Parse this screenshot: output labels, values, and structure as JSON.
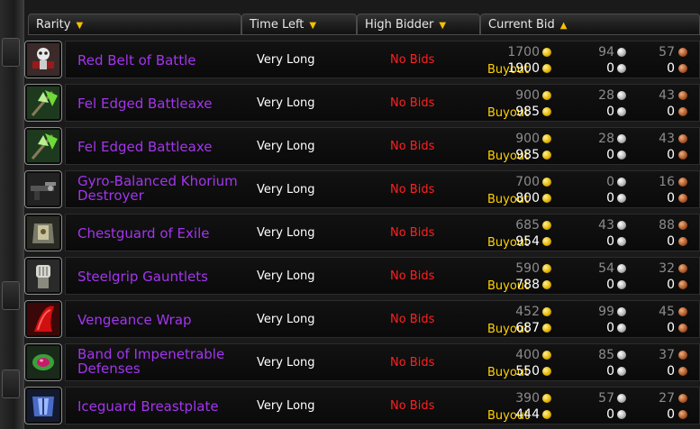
{
  "columns": [
    {
      "label": "Rarity",
      "sort": "desc"
    },
    {
      "label": "Time Left",
      "sort": "desc"
    },
    {
      "label": "High Bidder",
      "sort": "desc"
    },
    {
      "label": "Current Bid",
      "sort": "asc"
    }
  ],
  "buyout_label": "Buyout",
  "colors": {
    "epic": "#a335ee",
    "no_bids": "#ff2020",
    "buyout": "#ffd100"
  },
  "items": [
    {
      "name": "Red Belt of Battle",
      "icon": "belt-icon",
      "time": "Very Long",
      "bidder": "No Bids",
      "bid": {
        "g": "1700",
        "s": "94",
        "c": "57"
      },
      "buyout": {
        "g": "1900",
        "s": "0",
        "c": "0"
      }
    },
    {
      "name": "Fel Edged Battleaxe",
      "icon": "battleaxe-icon",
      "time": "Very Long",
      "bidder": "No Bids",
      "bid": {
        "g": "900",
        "s": "28",
        "c": "43"
      },
      "buyout": {
        "g": "985",
        "s": "0",
        "c": "0"
      }
    },
    {
      "name": "Fel Edged Battleaxe",
      "icon": "battleaxe-icon",
      "time": "Very Long",
      "bidder": "No Bids",
      "bid": {
        "g": "900",
        "s": "28",
        "c": "43"
      },
      "buyout": {
        "g": "985",
        "s": "0",
        "c": "0"
      }
    },
    {
      "name": "Gyro-Balanced Khorium Destroyer",
      "icon": "gun-icon",
      "time": "Very Long",
      "bidder": "No Bids",
      "bid": {
        "g": "700",
        "s": "0",
        "c": "16"
      },
      "buyout": {
        "g": "800",
        "s": "0",
        "c": "0"
      }
    },
    {
      "name": "Chestguard of Exile",
      "icon": "chestguard-icon",
      "time": "Very Long",
      "bidder": "No Bids",
      "bid": {
        "g": "685",
        "s": "43",
        "c": "88"
      },
      "buyout": {
        "g": "954",
        "s": "0",
        "c": "0"
      }
    },
    {
      "name": "Steelgrip Gauntlets",
      "icon": "gauntlets-icon",
      "time": "Very Long",
      "bidder": "No Bids",
      "bid": {
        "g": "590",
        "s": "54",
        "c": "32"
      },
      "buyout": {
        "g": "788",
        "s": "0",
        "c": "0"
      }
    },
    {
      "name": "Vengeance Wrap",
      "icon": "cloak-icon",
      "time": "Very Long",
      "bidder": "No Bids",
      "bid": {
        "g": "452",
        "s": "99",
        "c": "45"
      },
      "buyout": {
        "g": "687",
        "s": "0",
        "c": "0"
      }
    },
    {
      "name": "Band of Impenetrable Defenses",
      "icon": "ring-icon",
      "time": "Very Long",
      "bidder": "No Bids",
      "bid": {
        "g": "400",
        "s": "85",
        "c": "37"
      },
      "buyout": {
        "g": "550",
        "s": "0",
        "c": "0"
      }
    },
    {
      "name": "Iceguard Breastplate",
      "icon": "breastplate-icon",
      "time": "Very Long",
      "bidder": "No Bids",
      "bid": {
        "g": "390",
        "s": "57",
        "c": "27"
      },
      "buyout": {
        "g": "444",
        "s": "0",
        "c": "0"
      }
    }
  ]
}
